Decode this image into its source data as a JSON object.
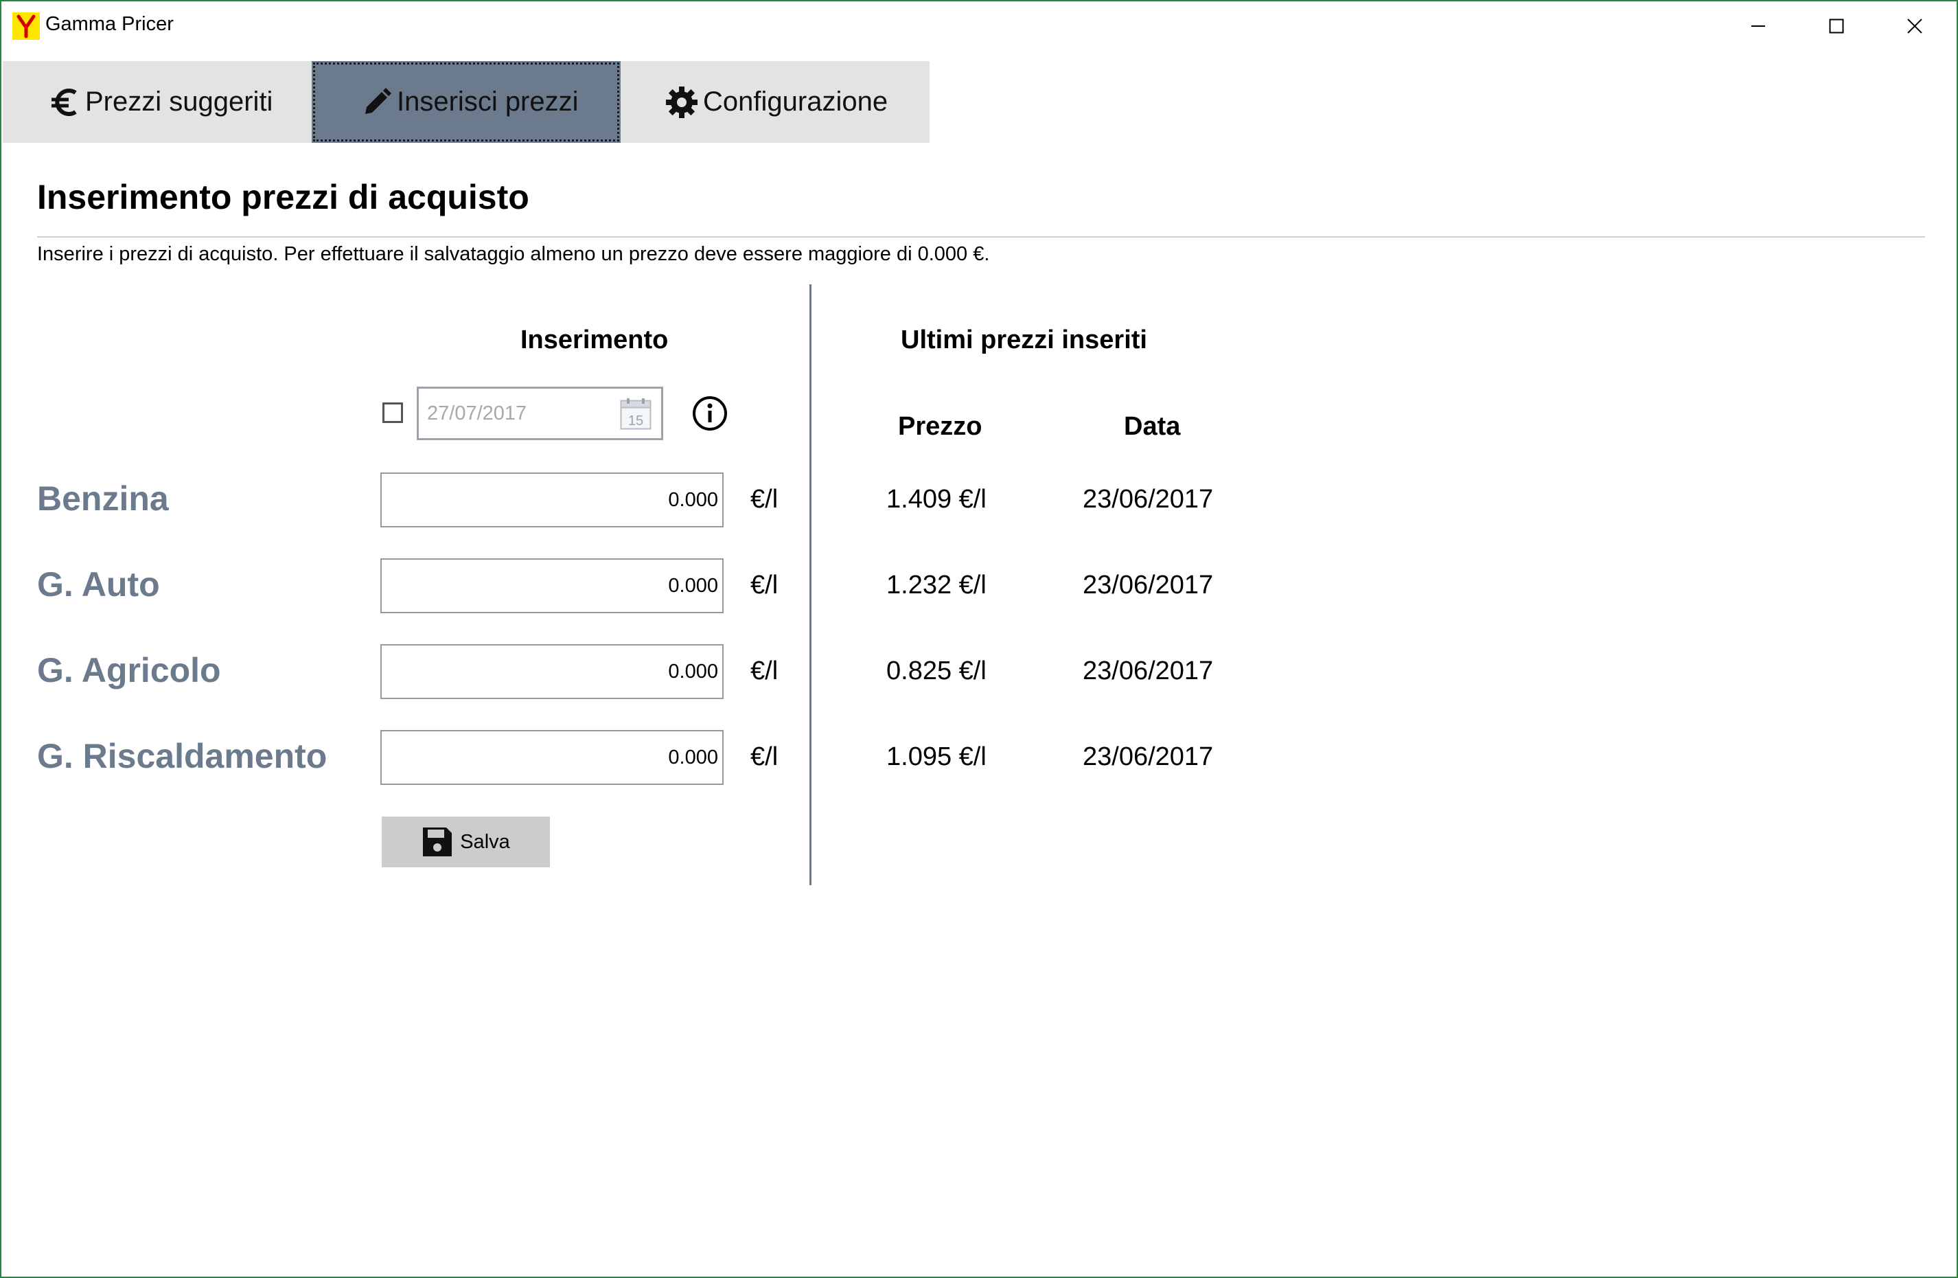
{
  "window": {
    "title": "Gamma Pricer",
    "accent_border": "#1f8a3c",
    "controls": [
      "minimize-icon",
      "maximize-icon",
      "close-icon"
    ]
  },
  "tabs": [
    {
      "label": "Prezzi suggeriti",
      "icon": "euro-icon",
      "active": false
    },
    {
      "label": "Inserisci prezzi",
      "icon": "pencil-icon",
      "active": true
    },
    {
      "label": "Configurazione",
      "icon": "gear-icon",
      "active": false
    }
  ],
  "page": {
    "title": "Inserimento prezzi di acquisto",
    "subtitle": "Inserire i prezzi di acquisto. Per effettuare il salvataggio almeno un prezzo deve essere maggiore di 0.000 €."
  },
  "entry": {
    "heading": "Inserimento",
    "date_checkbox_checked": false,
    "date_value": "27/07/2017",
    "calendar_icon_day": "15",
    "info_icon": "info-icon",
    "unit": "€/l",
    "save_label": "Salva",
    "save_icon": "floppy-disk-icon"
  },
  "history": {
    "heading": "Ultimi prezzi inseriti",
    "col_price": "Prezzo",
    "col_date": "Data"
  },
  "fuels": [
    {
      "label": "Benzina",
      "value": "0.000",
      "last_price": "1.409 €/l",
      "last_date": "23/06/2017"
    },
    {
      "label": "G. Auto",
      "value": "0.000",
      "last_price": "1.232 €/l",
      "last_date": "23/06/2017"
    },
    {
      "label": "G. Agricolo",
      "value": "0.000",
      "last_price": "0.825 €/l",
      "last_date": "23/06/2017"
    },
    {
      "label": "G. Riscaldamento",
      "value": "0.000",
      "last_price": "1.095 €/l",
      "last_date": "23/06/2017"
    }
  ],
  "colors": {
    "active_tab": "#6b7a8c",
    "tab_strip": "#e3e3e3",
    "fuel_label": "#6b7a8c",
    "app_icon_bg": "#ffe600",
    "app_icon_fg": "#d40000"
  }
}
